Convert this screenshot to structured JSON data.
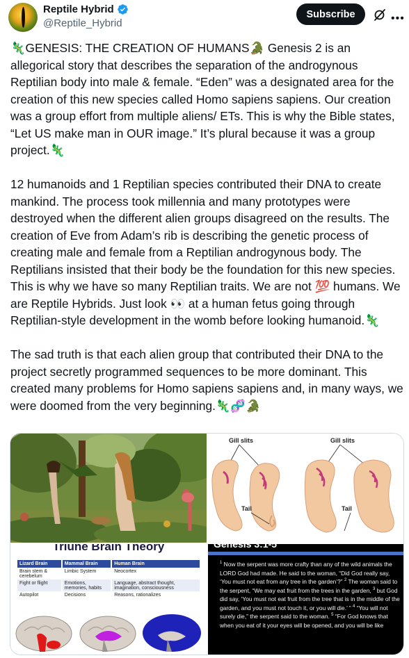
{
  "author": {
    "display_name": "Reptile Hybrid",
    "handle": "@Reptile_Hybrid",
    "verified": true,
    "avatar_icon": "reptile-eye-avatar"
  },
  "actions": {
    "subscribe_label": "Subscribe",
    "grok_icon": "grok-slash-icon",
    "more_icon": "more-horizontal-icon"
  },
  "tweet": {
    "paragraphs": [
      "🦎GENESIS: THE CREATION OF HUMANS🐊 Genesis 2 is an allegorical story that describes the separation of the androgynous Reptilian body into male & female. “Eden” was a designated area for the creation of this new species called Homo sapiens sapiens. Our creation was a group effort from multiple aliens/ ETs. This is why the Bible states, “Let US make man in OUR image.” It’s plural because it was a group project.🦎",
      "12 humanoids and 1 Reptilian species contributed their DNA to create mankind. The process took millennia and many prototypes were destroyed when the different alien groups disagreed on the results. The creation of Eve from Adam’s rib is describing the genetic process of creating male and female from a Reptilian androgynous body. The Reptilians insisted that their body be the foundation for this new species. This is why we have so many Reptilian traits. We are not 💯 humans. We are Reptile Hybrids. Just look 👀 at a human fetus going through Reptilian-style development in the womb before looking humanoid.🦎",
      "The sad truth is that each alien group that contributed their DNA to the project secretly programmed sequences to be more dominant. This created many problems for Homo sapiens sapiens and, in many ways, we were doomed from the very beginning.🦎🧬🐊"
    ]
  },
  "media": {
    "embryo": {
      "label_gill_left": "Gill slits",
      "label_gill_right": "Gill slits",
      "label_tail_left": "Tail",
      "label_tail_right": "Tail"
    },
    "brain": {
      "title": "Triune Brain Theory",
      "headers": [
        "Lizard Brain",
        "Mammal Brain",
        "Human Brain"
      ],
      "rows": [
        [
          "Brain stem & cerebelum",
          "Limbic System",
          "Neocortex"
        ],
        [
          "Fight or flight",
          "Emotions, memories, habits",
          "Language, abstract thought, imagination, consciousness"
        ],
        [
          "Autopilot",
          "Decisions",
          "Reasons, rationalizes"
        ]
      ],
      "colors": [
        "#e01818",
        "#c020e0",
        "#1e22b8"
      ]
    },
    "bible": {
      "heading": "Genesis 3:1-5",
      "v1_num": "1",
      "v1": "Now the serpent was more crafty than any of the wild animals the LORD God had made. He said to the woman, “Did God really say, ‘You must not eat from any tree in the garden’?”",
      "v2_num": "2",
      "v2": "The woman said to the serpent, “We may eat fruit from the trees in the garden,",
      "v3_num": "3",
      "v3": "but God did say, ‘You must not eat fruit from the tree that is in the middle of the garden, and you must not touch it, or you will die.’ ”",
      "v4_num": "4",
      "v4": "“You will not surely die,” the serpent said to the woman.",
      "v5_num": "5",
      "v5": "“For God knows that when you eat of it your eyes will be opened, and you will be like"
    }
  }
}
